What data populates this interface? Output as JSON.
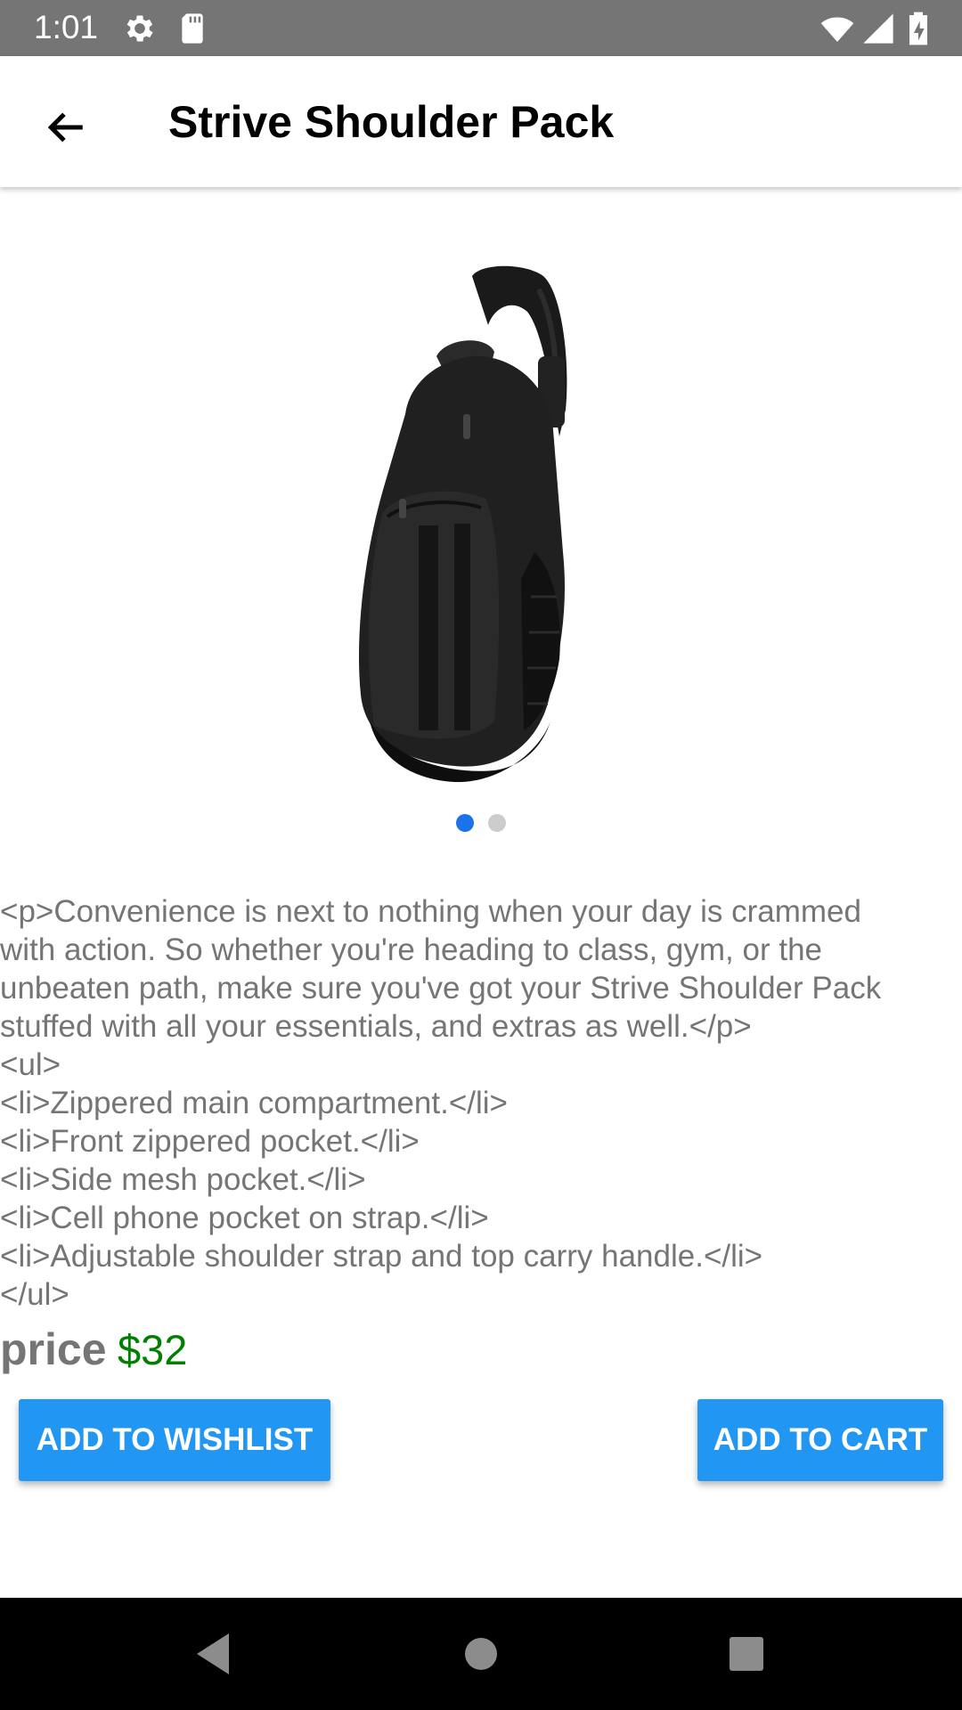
{
  "status_bar": {
    "time": "1:01",
    "icons": [
      "gear-icon",
      "sd-card-icon",
      "wifi-icon",
      "cell-signal-icon",
      "battery-charging-icon"
    ]
  },
  "app_bar": {
    "back_icon": "arrow-back-icon",
    "title": "Strive Shoulder Pack"
  },
  "carousel": {
    "image": "black shoulder backpack",
    "page_count": 2,
    "active_page": 1,
    "colors": {
      "active": "#1a73e8",
      "inactive": "#cccccc"
    }
  },
  "description_lines": [
    "<p>Convenience is next to nothing when your day is crammed",
    "with action. So whether you're heading to class, gym, or the",
    "unbeaten path, make sure you've got your Strive Shoulder Pack",
    "stuffed with all your essentials, and extras as well.</p>",
    "<ul>",
    "<li>Zippered main compartment.</li>",
    "<li>Front zippered pocket.</li>",
    "<li>Side mesh pocket.</li>",
    "<li>Cell phone pocket on strap.</li>",
    "<li>Adjustable shoulder strap and top carry handle.</li>",
    "</ul>"
  ],
  "price": {
    "label": "price",
    "value": "$32",
    "color": "#008000"
  },
  "buttons": {
    "wishlist": "ADD TO WISHLIST",
    "cart": "ADD TO CART",
    "color": "#2196f3"
  },
  "nav_bar": {
    "icons": [
      "nav-back-icon",
      "nav-home-icon",
      "nav-recents-icon"
    ]
  }
}
